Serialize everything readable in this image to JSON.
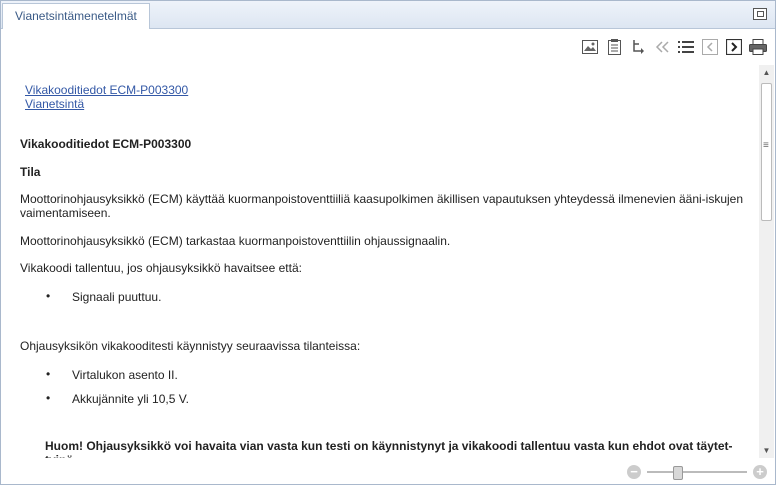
{
  "tab": {
    "label": "Vianetsintämenetelmät"
  },
  "toolbar": {
    "icons": [
      "image-icon",
      "document-icon",
      "branch-icon",
      "double-chevron-left-icon",
      "list-icon",
      "prev-icon",
      "next-icon",
      "print-icon"
    ]
  },
  "links": [
    "Vikakooditiedot ECM-P003300",
    "Vianetsintä"
  ],
  "content": {
    "heading": "Vikakooditiedot ECM-P003300",
    "subheading": "Tila",
    "p1": "Moottorinohjausyksikkö (ECM) käyttää kuormanpoistoventtiiliä kaasupolkimen äkillisen vapautuksen yhteydessä ilmenevien ääni-iskujen vaimentamiseen.",
    "p2": "Moottorinohjausyksikkö (ECM) tarkastaa kuormanpoistoventtiilin ohjaussignaalin.",
    "p3": "Vikakoodi tallentuu, jos ohjausyksikkö havaitsee että:",
    "bullets1": [
      "Signaali puuttuu."
    ],
    "p4": "Ohjausyksikön vikakooditesti käynnistyy seuraavissa tilanteissa:",
    "bullets2": [
      "Virtalukon asento II.",
      "Akkujännite yli 10,5 V."
    ],
    "note": "Huom! Ohjausyksikkö voi havaita vian vasta kun testi on käynnistynyt ja vikakoodi tallentuu vasta kun ehdot ovat täytet-tyinä."
  },
  "zoom": {
    "level_fraction": 0.3
  }
}
